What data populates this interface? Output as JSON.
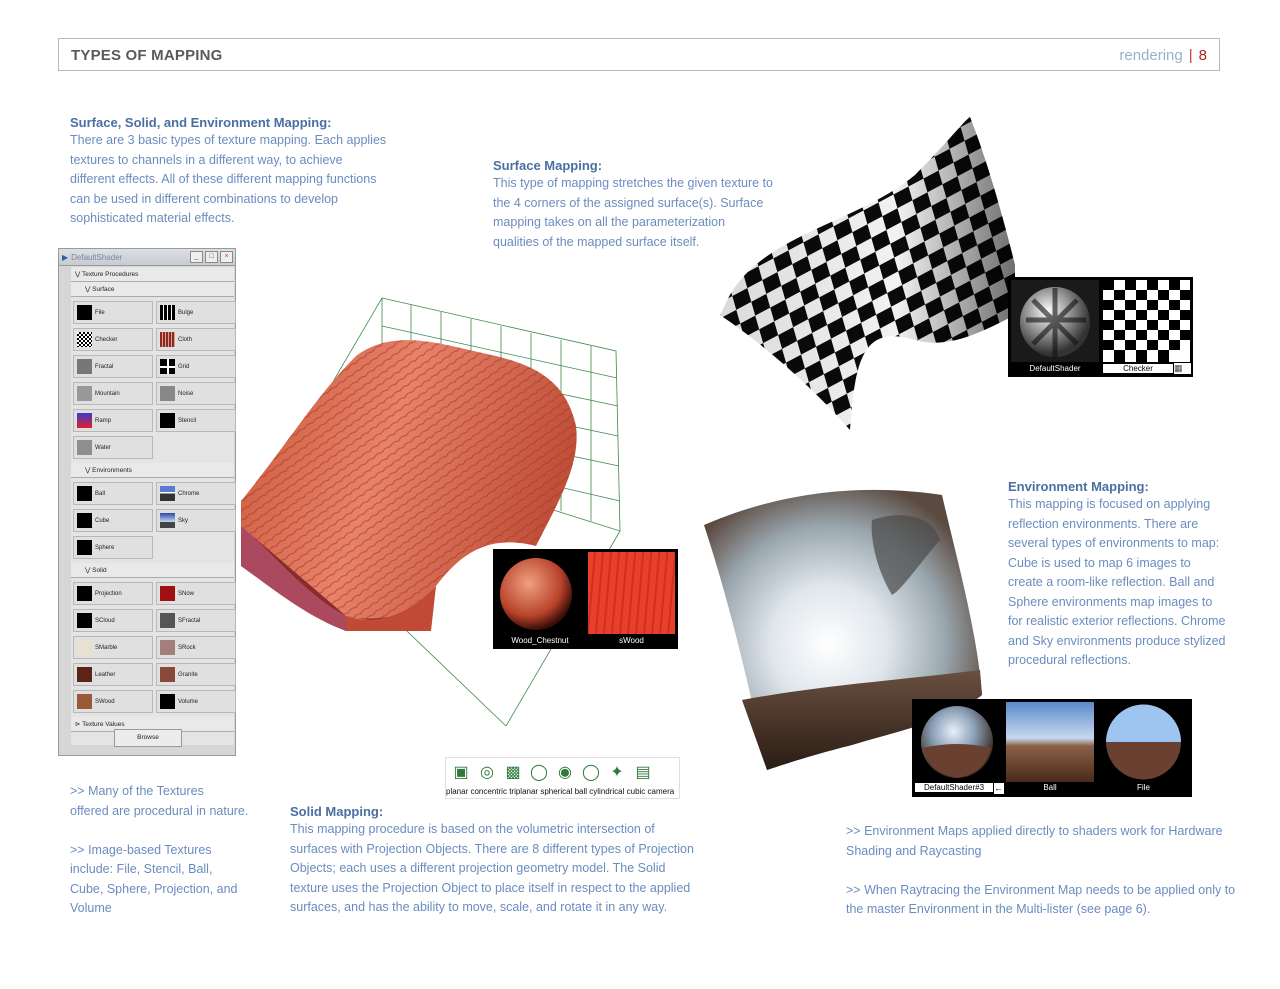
{
  "header": {
    "title": "TYPES OF MAPPING",
    "section": "rendering",
    "separator": "|",
    "page": "8"
  },
  "intro": {
    "heading": "Surface, Solid, and Environment Mapping:",
    "lines": [
      "There are 3 basic types of texture mapping. Each applies",
      "textures to channels in a different way, to achieve",
      "different effects. All of these different mapping functions",
      "can be used in different combinations to develop",
      "sophisticated material effects."
    ]
  },
  "surface": {
    "heading": "Surface Mapping:",
    "lines": [
      "This type of mapping stretches the given texture to",
      "the 4 corners of the assigned surface(s).  Surface",
      "mapping takes on all the parameterization",
      "qualities of the mapped surface itself."
    ]
  },
  "environment": {
    "heading": "Environment Mapping:",
    "lines": [
      "This mapping is focused on applying",
      "reflection environments. There are",
      "several types of environments to map:",
      "Cube is used to map 6 images to",
      "create a room-like reflection. Ball and",
      "Sphere environments map images to",
      "for realistic exterior reflections. Chrome",
      "and Sky environments produce stylized",
      "procedural reflections."
    ]
  },
  "notes_left": {
    "lines": [
      ">> Many of the Textures",
      "offered are procedural in nature.",
      "",
      ">> Image-based Textures",
      "include: File, Stencil, Ball,",
      "Cube, Sphere, Projection, and",
      "Volume"
    ]
  },
  "solid": {
    "heading": "Solid Mapping:",
    "lines": [
      "This mapping procedure is based on the volumetric intersection of",
      "surfaces with Projection Objects. There are 8 different types of Projection",
      "Objects; each uses a different projection geometry model. The Solid",
      "texture uses the Projection Object to place itself in respect to the applied",
      "surfaces, and has the ability to move, scale, and rotate it in any way."
    ]
  },
  "notes_right": {
    "lines": [
      ">> Environment Maps applied directly to shaders work for Hardware",
      "Shading and Raycasting",
      "",
      ">> When Raytracing the Environment Map needs to be applied only to",
      "the master Environment in the Multi-lister (see page 6)."
    ]
  },
  "shader_window": {
    "title": "DefaultShader",
    "section_procedures": "Texture Procedures",
    "section_surface": "Surface",
    "surface_items": [
      {
        "left": "File",
        "right": "Bulge"
      },
      {
        "left": "Checker",
        "right": "Cloth"
      },
      {
        "left": "Fractal",
        "right": "Grid"
      },
      {
        "left": "Mountain",
        "right": "Noise"
      },
      {
        "left": "Ramp",
        "right": "Stencil"
      },
      {
        "left": "Water",
        "right": ""
      }
    ],
    "section_environments": "Environments",
    "environment_items": [
      {
        "left": "Ball",
        "right": "Chrome"
      },
      {
        "left": "Cube",
        "right": "Sky"
      },
      {
        "left": "Sphere",
        "right": ""
      }
    ],
    "section_solid": "Solid",
    "solid_items": [
      {
        "left": "Projection",
        "right": "SNow"
      },
      {
        "left": "SCloud",
        "right": "SFractal"
      },
      {
        "left": "SMarble",
        "right": "SRock"
      },
      {
        "left": "Leather",
        "right": "Granite"
      },
      {
        "left": "SWood",
        "right": "Volume"
      }
    ],
    "section_values": "Texture Values",
    "browse_label": "Browse"
  },
  "wood_swatches": {
    "left": "Wood_Chestnut",
    "right": "sWood"
  },
  "checker_swatches": {
    "left": "DefaultShader",
    "right": "Checker"
  },
  "env_swatches": {
    "left": "DefaultShader#3",
    "mid": "Ball",
    "right": "File"
  },
  "projection_icons": {
    "labels": [
      "planar",
      "concentric",
      "triplanar",
      "spherical",
      "ball",
      "cylindrical",
      "cubic",
      "camera"
    ]
  }
}
